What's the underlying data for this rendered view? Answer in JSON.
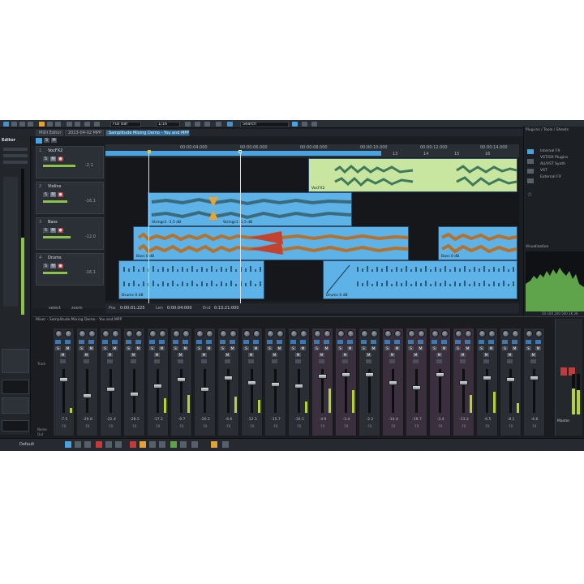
{
  "toolbar": {
    "mode_value": "Full bar",
    "grid_value": "1/16",
    "search_placeholder": "Search"
  },
  "tabs": [
    {
      "label": "MIDI Editor"
    },
    {
      "label": "2023-04-02 MPP"
    },
    {
      "label": "Samplitude Mixing Demo - You and MPP"
    }
  ],
  "left_panel": {
    "title": "Editor"
  },
  "tracks": [
    {
      "num": "1",
      "name": "VocFX2",
      "vol": "-2.1"
    },
    {
      "num": "2",
      "name": "Violins",
      "vol": "-16.1"
    },
    {
      "num": "3",
      "name": "Bass",
      "vol": "-12.0"
    },
    {
      "num": "4",
      "name": "Drums",
      "vol": "-16.1"
    }
  ],
  "ruler": [
    "4",
    "5",
    "6",
    "7",
    "8",
    "9",
    "10",
    "11",
    "12",
    "13",
    "14",
    "15",
    "16"
  ],
  "ruler_times": [
    "00:00:04.000",
    "00:00:06.000",
    "00:00:08.000",
    "00:00:10.000",
    "00:00:12.000",
    "00:00:14.000",
    "00:00:16.000"
  ],
  "clips": {
    "vocal_right": "VocFX2",
    "strings_a": "Strings1  -1.5 dB",
    "strings_b": "Strings1  -1.5 dB",
    "bass_a": "Bass  0 dB",
    "bass_b": "Bass  0 dB",
    "drums_a": "Drums  0 dB",
    "drums_b": "Drums  0 dB"
  },
  "transport": {
    "labels": [
      "Pos",
      "Len",
      "End"
    ],
    "values": [
      "0:00:01:225",
      "0:00:04:000",
      "0:13:21:000"
    ],
    "extra": [
      "select",
      "zoom",
      "4 x"
    ]
  },
  "browser": {
    "title": "Plug-ins / Tools / Sheets",
    "items": [
      "Internal FX",
      "VST/DX Plugins",
      "AU/VST Synth",
      "VST",
      "External FX"
    ],
    "vis_title": "Visualization",
    "vis_labels": [
      "50",
      "100",
      "200",
      "500",
      "1K",
      "2K"
    ]
  },
  "mixer": {
    "title": "Mixer - Samplitude Mixing Demo - You and MPP",
    "strip_values": [
      "-7.5",
      "-29.8",
      "-22.4",
      "-28.5",
      "-17.2",
      "-9.7",
      "-20.2",
      "-6.6",
      "-12.5",
      "-15.7",
      "-16.5",
      "-4.9",
      "-3.4",
      "-2.2",
      "-14.4",
      "-19.7",
      "-3.4",
      "-13.2",
      "-6.5",
      "-8.1",
      "-6.6"
    ],
    "master_label": "Master",
    "side_labels": [
      "Track",
      "Name",
      "Out"
    ]
  },
  "status": {
    "preset": "Default"
  },
  "colors": {
    "accent": "#4aa3df",
    "clip_blue": "#5db3e8",
    "clip_green": "#c8e6a0",
    "meter": "#b5d334"
  }
}
